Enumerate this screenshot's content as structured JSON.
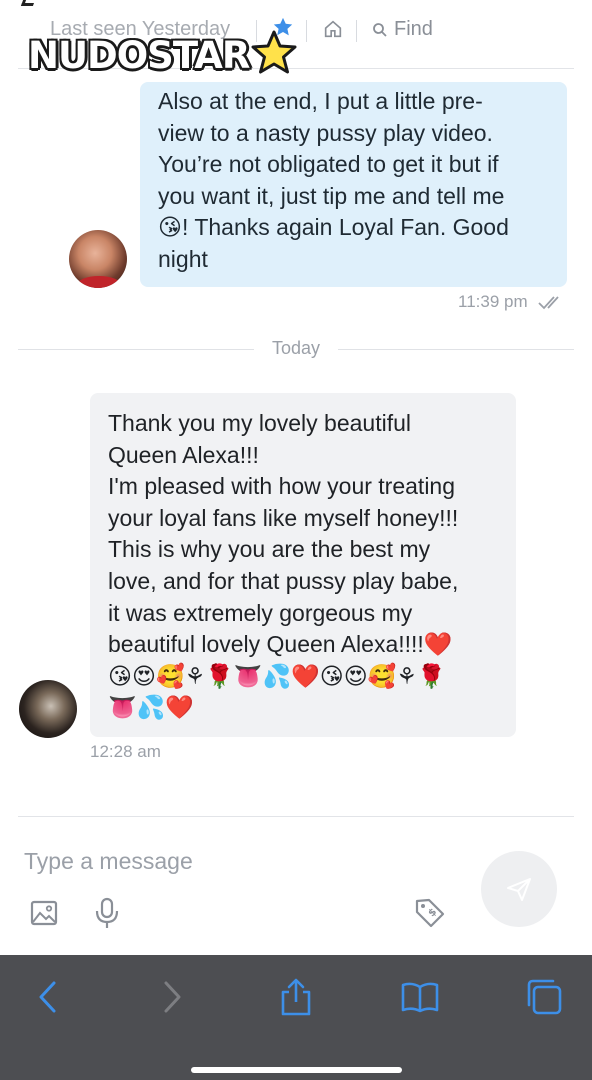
{
  "header": {
    "status": "Last seen Yesterday",
    "find_label": "Find",
    "icons": [
      "chevron-left-icon",
      "star-icon",
      "home-icon",
      "search-icon"
    ]
  },
  "watermark": {
    "text": "NUDOSTAR"
  },
  "messages": [
    {
      "direction": "outgoing",
      "text": "Also at the end, I put a little pre-\nview to a nasty pussy play video.\nYou’re not obligated to get it but if\nyou want it, just tip me and tell me\n😘! Thanks again Loyal Fan. Good\nnight",
      "time": "11:39 pm",
      "status_icon": "double-check-icon"
    },
    {
      "direction": "incoming",
      "text": "Thank you my lovely beautiful\nQueen Alexa!!!\nI'm pleased with how your treating\nyour loyal fans like myself honey!!!\nThis is why you are the best my\nlove, and for that pussy play babe,\nit was extremely gorgeous my\nbeautiful lovely Queen Alexa!!!!❤️\n😘😍🥰⚘🌹👅💦❤️😘😍🥰⚘🌹\n👅💦❤️",
      "time": "12:28 am"
    }
  ],
  "day_separator": "Today",
  "composer": {
    "placeholder": "Type a message",
    "tools": [
      "image-icon",
      "microphone-icon",
      "price-tag-icon"
    ],
    "send_icon": "paper-plane-icon"
  },
  "browser_toolbar": {
    "buttons": [
      "back",
      "forward",
      "share",
      "bookmarks",
      "tabs"
    ]
  },
  "colors": {
    "accent": "#00aff0",
    "outgoing_bubble": "#dff0fb",
    "incoming_bubble": "#f1f2f4",
    "toolbar_bg": "#4d4e52",
    "toolbar_icon": "#3d8fe8",
    "meta_text": "#9ba0a8"
  }
}
